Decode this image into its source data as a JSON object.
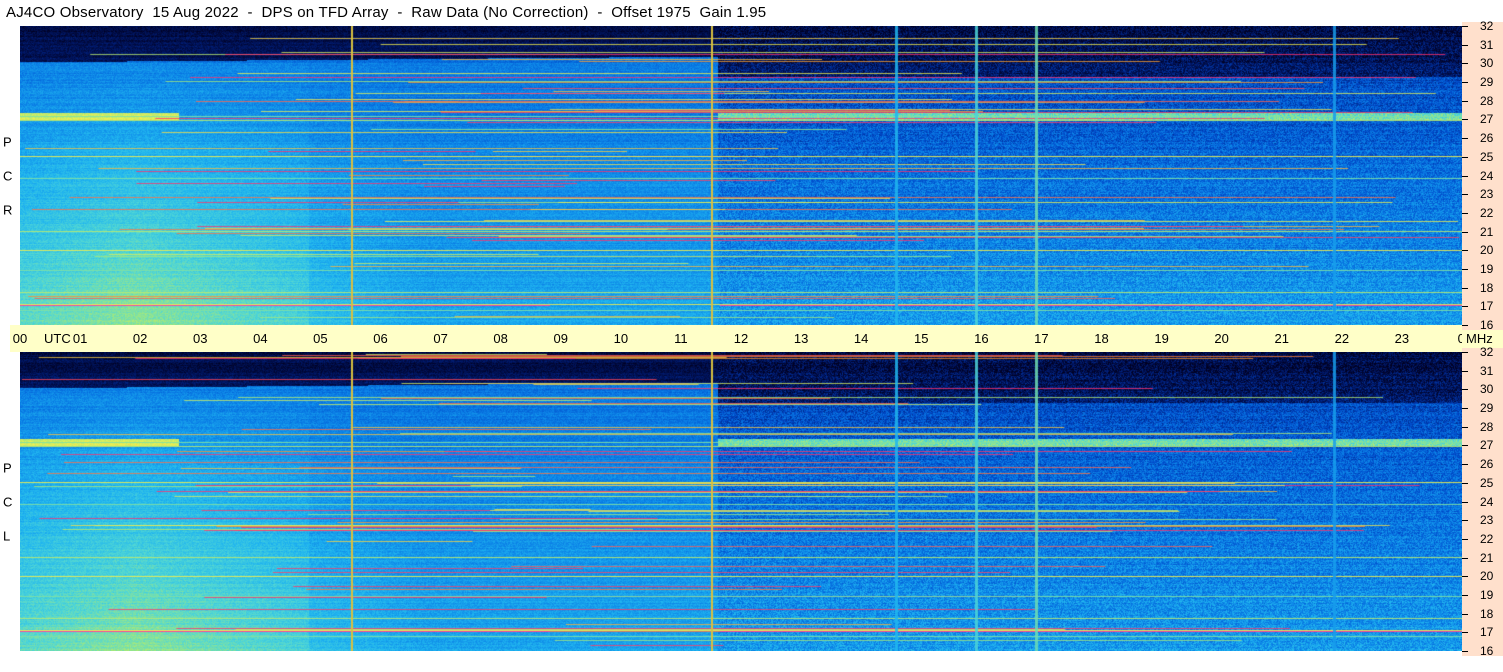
{
  "title": "AJ4CO Observatory  15 Aug 2022  -  DPS on TFD Array  -  Raw Data (No Correction)  -  Offset 1975  Gain 1.95",
  "chart_data": {
    "type": "heatmap",
    "time_axis": {
      "ticks": [
        "00",
        "01",
        "02",
        "03",
        "04",
        "05",
        "06",
        "07",
        "08",
        "09",
        "10",
        "11",
        "12",
        "13",
        "14",
        "15",
        "16",
        "17",
        "18",
        "19",
        "20",
        "21",
        "22",
        "23",
        "00"
      ],
      "utc_label": "UTC",
      "end_unit": "MHz"
    },
    "freq_axis": {
      "range": [
        16,
        32
      ],
      "ticks": [
        32,
        31,
        30,
        29,
        28,
        27,
        26,
        25,
        24,
        23,
        22,
        21,
        20,
        19,
        18,
        17,
        16
      ]
    },
    "panels": [
      {
        "name": "RCP",
        "letters": [
          "P",
          "C",
          "R"
        ]
      },
      {
        "name": "LCP",
        "letters": [
          "P",
          "C",
          "L"
        ]
      }
    ],
    "colormap": [
      "#000020",
      "#001a6e",
      "#0048c8",
      "#0a7ee6",
      "#1fb4f0",
      "#4fd6d6",
      "#a0e880",
      "#f0f050",
      "#ff9030",
      "#ff3070"
    ]
  }
}
